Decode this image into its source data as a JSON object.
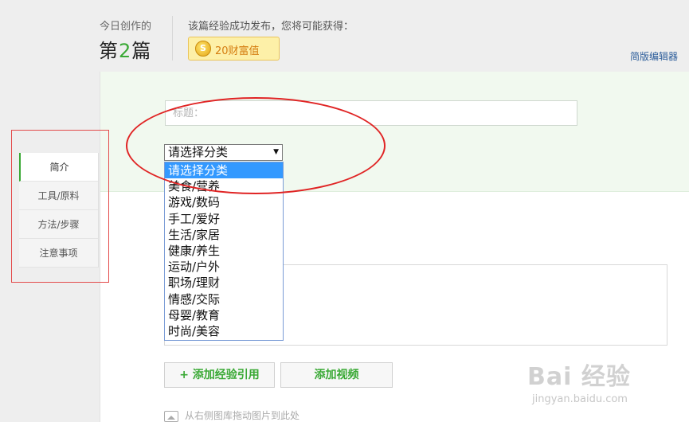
{
  "header": {
    "today_label": "今日创作的",
    "today_prefix": "第",
    "today_count": "2",
    "today_suffix": "篇",
    "reward_label": "该篇经验成功发布，您将可能获得：",
    "coin_symbol": "S",
    "coin_text": "20财富值",
    "simple_editor": "简版编辑器"
  },
  "form": {
    "title_placeholder": "标题："
  },
  "category_select": {
    "selected": "请选择分类",
    "options": [
      "请选择分类",
      "美食/营养",
      "游戏/数码",
      "手工/爱好",
      "生活/家居",
      "健康/养生",
      "运动/户外",
      "职场/理财",
      "情感/交际",
      "母婴/教育",
      "时尚/美容"
    ]
  },
  "side_nav": {
    "items": [
      "简介",
      "工具/原料",
      "方法/步骤",
      "注意事项"
    ]
  },
  "buttons": {
    "add_quote": "+ 添加经验引用",
    "add_video": "添加视频"
  },
  "drag_hint": "从右侧图库拖动图片到此处",
  "watermark": {
    "main": "Bai 经验",
    "sub": "jingyan.baidu.com"
  },
  "colors": {
    "accent_green": "#3aa935",
    "annotation_red": "#e02424",
    "selection_blue": "#3399ff",
    "coin_badge_bg": "#fdf0a8"
  }
}
